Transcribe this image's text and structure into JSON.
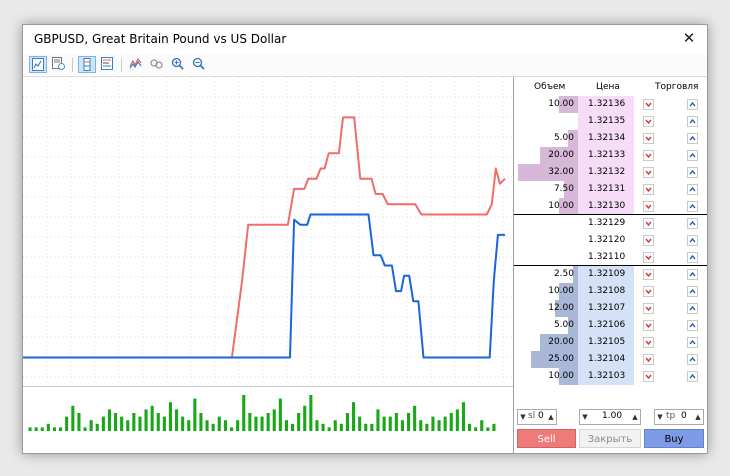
{
  "window": {
    "title": "GBPUSD, Great Britain Pound vs US Dollar",
    "close_glyph": "✕"
  },
  "toolbar": {
    "icons": [
      "line-chart-icon",
      "chart-settings-icon",
      "depth-of-market-icon",
      "depth-ticks-icon",
      "tick-chart-icon",
      "link-icon",
      "zoom-in-icon",
      "zoom-out-icon"
    ],
    "active": [
      "line-chart-icon",
      "depth-of-market-icon"
    ]
  },
  "colors": {
    "ask_line": "#f26c6c",
    "bid_line": "#1a66d9",
    "volume_bar": "#18a818",
    "ask_bg": "#f6dcf7",
    "bid_bg": "#d4e1f6",
    "ask_volume_bar": "#d8b8d8",
    "bid_volume_bar": "#a9b8d6",
    "sell_button": "#ef7a7a",
    "buy_button": "#7d9be6"
  },
  "depth": {
    "headers": {
      "volume": "Объем",
      "price": "Цена",
      "trade": "Торговля"
    },
    "asks": [
      {
        "volume": "10.00",
        "price": "1.32136",
        "fill": 0.31
      },
      {
        "volume": "",
        "price": "1.32135",
        "fill": 0
      },
      {
        "volume": "5.00",
        "price": "1.32134",
        "fill": 0.16
      },
      {
        "volume": "20.00",
        "price": "1.32133",
        "fill": 0.63
      },
      {
        "volume": "32.00",
        "price": "1.32132",
        "fill": 1.0
      },
      {
        "volume": "7.50",
        "price": "1.32131",
        "fill": 0.23
      },
      {
        "volume": "10.00",
        "price": "1.32130",
        "fill": 0.31
      }
    ],
    "spread": [
      {
        "volume": "",
        "price": "1.32129"
      },
      {
        "volume": "",
        "price": "1.32120"
      },
      {
        "volume": "",
        "price": "1.32110"
      }
    ],
    "bids": [
      {
        "volume": "2.50",
        "price": "1.32109",
        "fill": 0.08
      },
      {
        "volume": "10.00",
        "price": "1.32108",
        "fill": 0.31
      },
      {
        "volume": "12.00",
        "price": "1.32107",
        "fill": 0.38
      },
      {
        "volume": "5.00",
        "price": "1.32106",
        "fill": 0.16
      },
      {
        "volume": "20.00",
        "price": "1.32105",
        "fill": 0.63
      },
      {
        "volume": "25.00",
        "price": "1.32104",
        "fill": 0.78
      },
      {
        "volume": "10.00",
        "price": "1.32103",
        "fill": 0.31
      }
    ]
  },
  "order_panel": {
    "sl_label": "sl",
    "sl_value": "0",
    "volume_value": "1.00",
    "tp_label": "tp",
    "tp_value": "0",
    "sell_label": "Sell",
    "close_label": "Закрыть",
    "buy_label": "Buy"
  },
  "tick_chart": {
    "ask_levels": [
      0,
      0,
      0,
      0,
      0,
      0,
      0,
      0,
      0,
      0,
      0,
      0,
      0,
      0,
      0,
      0,
      0,
      0,
      0,
      0,
      0,
      0,
      0,
      0,
      0,
      0,
      0,
      0,
      0,
      0,
      0,
      0,
      0,
      0,
      0,
      0,
      0,
      0,
      0,
      0,
      0,
      0,
      0,
      0,
      0,
      0,
      0,
      0,
      0,
      0,
      0,
      0,
      0,
      0,
      0,
      0,
      0,
      0,
      0,
      0,
      0,
      0,
      0,
      0,
      0,
      0,
      0,
      0,
      0,
      0,
      0,
      0,
      0,
      0,
      0,
      0,
      0,
      0,
      0,
      0,
      0,
      0,
      0,
      0,
      0,
      0,
      0,
      0,
      0,
      0,
      0,
      0,
      0,
      0,
      0,
      0,
      0,
      0,
      0,
      0,
      0,
      0,
      0,
      0,
      0,
      0,
      0,
      0,
      0,
      0,
      0,
      0,
      0,
      0,
      0,
      0,
      0,
      0,
      0,
      0,
      0,
      0,
      0,
      0,
      0,
      0,
      0,
      0,
      0,
      0,
      0,
      0,
      0,
      0,
      0,
      0,
      0,
      0,
      0,
      0,
      0,
      0,
      0,
      0,
      0,
      0,
      0,
      0,
      0,
      0,
      0,
      0,
      0,
      0,
      0,
      0,
      0,
      0,
      0,
      0,
      0,
      0,
      0,
      0,
      0,
      0,
      0,
      0,
      0,
      0,
      0,
      0,
      0,
      0,
      0,
      0,
      0,
      0,
      0,
      0,
      0,
      0,
      0,
      0,
      0,
      0,
      0,
      0,
      0,
      0,
      0,
      0,
      0,
      0,
      0,
      0,
      0,
      0,
      0,
      0,
      0,
      0,
      0,
      0,
      0,
      0,
      0,
      0,
      0,
      0,
      0,
      0,
      0,
      0,
      0,
      0,
      0,
      0,
      0,
      0,
      0,
      0,
      0,
      0,
      0,
      0,
      0,
      0,
      0,
      0,
      0,
      0,
      0,
      0,
      0,
      0,
      0,
      0,
      0,
      0
    ],
    "ask_path": [
      [
        0,
        1.3206
      ],
      [
        205,
        1.3206
      ],
      [
        210,
        1.32075
      ],
      [
        215,
        1.3209
      ],
      [
        221,
        1.32112
      ],
      [
        260,
        1.32112
      ],
      [
        266,
        1.32126
      ],
      [
        276,
        1.32126
      ],
      [
        280,
        1.3213
      ],
      [
        288,
        1.3213
      ],
      [
        292,
        1.32134
      ],
      [
        296,
        1.32134
      ],
      [
        300,
        1.3214
      ],
      [
        310,
        1.3214
      ],
      [
        314,
        1.32154
      ],
      [
        325,
        1.32154
      ],
      [
        331,
        1.3213
      ],
      [
        342,
        1.3213
      ],
      [
        346,
        1.32124
      ],
      [
        353,
        1.32124
      ],
      [
        358,
        1.3212
      ],
      [
        385,
        1.3212
      ],
      [
        391,
        1.32116
      ],
      [
        455,
        1.32116
      ],
      [
        460,
        1.3212
      ],
      [
        464,
        1.32134
      ],
      [
        468,
        1.32128
      ],
      [
        473,
        1.3213
      ]
    ],
    "bid_path": [
      [
        0,
        1.3206
      ],
      [
        262,
        1.3206
      ],
      [
        266,
        1.32114
      ],
      [
        272,
        1.32112
      ],
      [
        279,
        1.32112
      ],
      [
        282,
        1.32116
      ],
      [
        339,
        1.32116
      ],
      [
        344,
        1.321
      ],
      [
        351,
        1.321
      ],
      [
        355,
        1.32096
      ],
      [
        362,
        1.32096
      ],
      [
        366,
        1.32086
      ],
      [
        371,
        1.32086
      ],
      [
        374,
        1.32092
      ],
      [
        379,
        1.32092
      ],
      [
        383,
        1.32082
      ],
      [
        388,
        1.32082
      ],
      [
        393,
        1.3206
      ],
      [
        425,
        1.3206
      ],
      [
        458,
        1.3206
      ],
      [
        462,
        1.3209
      ],
      [
        466,
        1.32108
      ],
      [
        473,
        1.32108
      ]
    ],
    "y_range": [
      1.3205,
      1.32162
    ],
    "x_range": [
      0,
      473
    ]
  },
  "volume_bars": [
    1,
    1,
    1,
    2,
    1,
    1,
    4,
    7,
    5,
    1,
    3,
    2,
    4,
    6,
    5,
    4,
    3,
    5,
    4,
    6,
    7,
    5,
    4,
    8,
    6,
    4,
    3,
    9,
    5,
    3,
    2,
    4,
    3,
    1,
    3,
    10,
    5,
    4,
    4,
    5,
    6,
    9,
    3,
    2,
    5,
    7,
    10,
    3,
    2,
    1,
    3,
    2,
    5,
    8,
    4,
    2,
    2,
    6,
    4,
    4,
    5,
    3,
    5,
    7,
    3,
    2,
    4,
    3,
    4,
    5,
    6,
    8,
    2,
    1,
    3,
    1,
    2
  ]
}
